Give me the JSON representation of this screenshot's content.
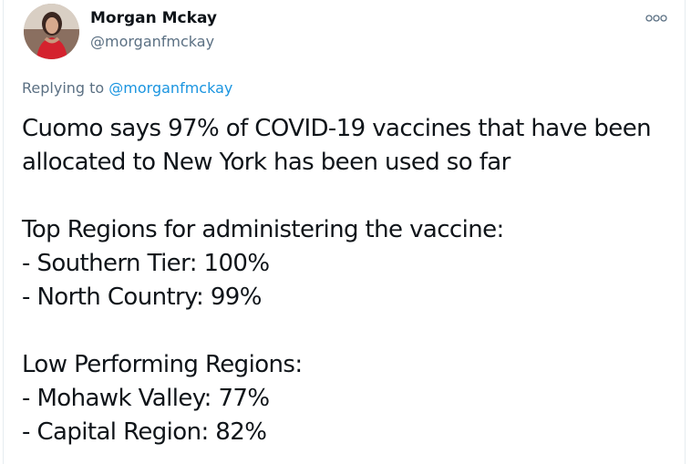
{
  "author": {
    "display_name": "Morgan Mckay",
    "handle": "@morganfmckay",
    "avatar_icon": "profile-photo-icon"
  },
  "more_icon": "more-options-icon",
  "reply": {
    "prefix": "Replying to ",
    "mention": "@morganfmckay"
  },
  "tweet": {
    "lines": [
      "Cuomo says 97% of COVID-19 vaccines that have been",
      "allocated to New York has been used so far",
      "Top Regions for administering the vaccine:",
      "- Southern Tier: 100%",
      "- North Country: 99%",
      "Low Performing Regions:",
      "- Mohawk Valley: 77%",
      "- Capital Region: 82%"
    ]
  },
  "colors": {
    "text": "#0f1419",
    "secondary": "#5b7083",
    "link": "#1b95e0",
    "border": "#e6ecf0"
  }
}
